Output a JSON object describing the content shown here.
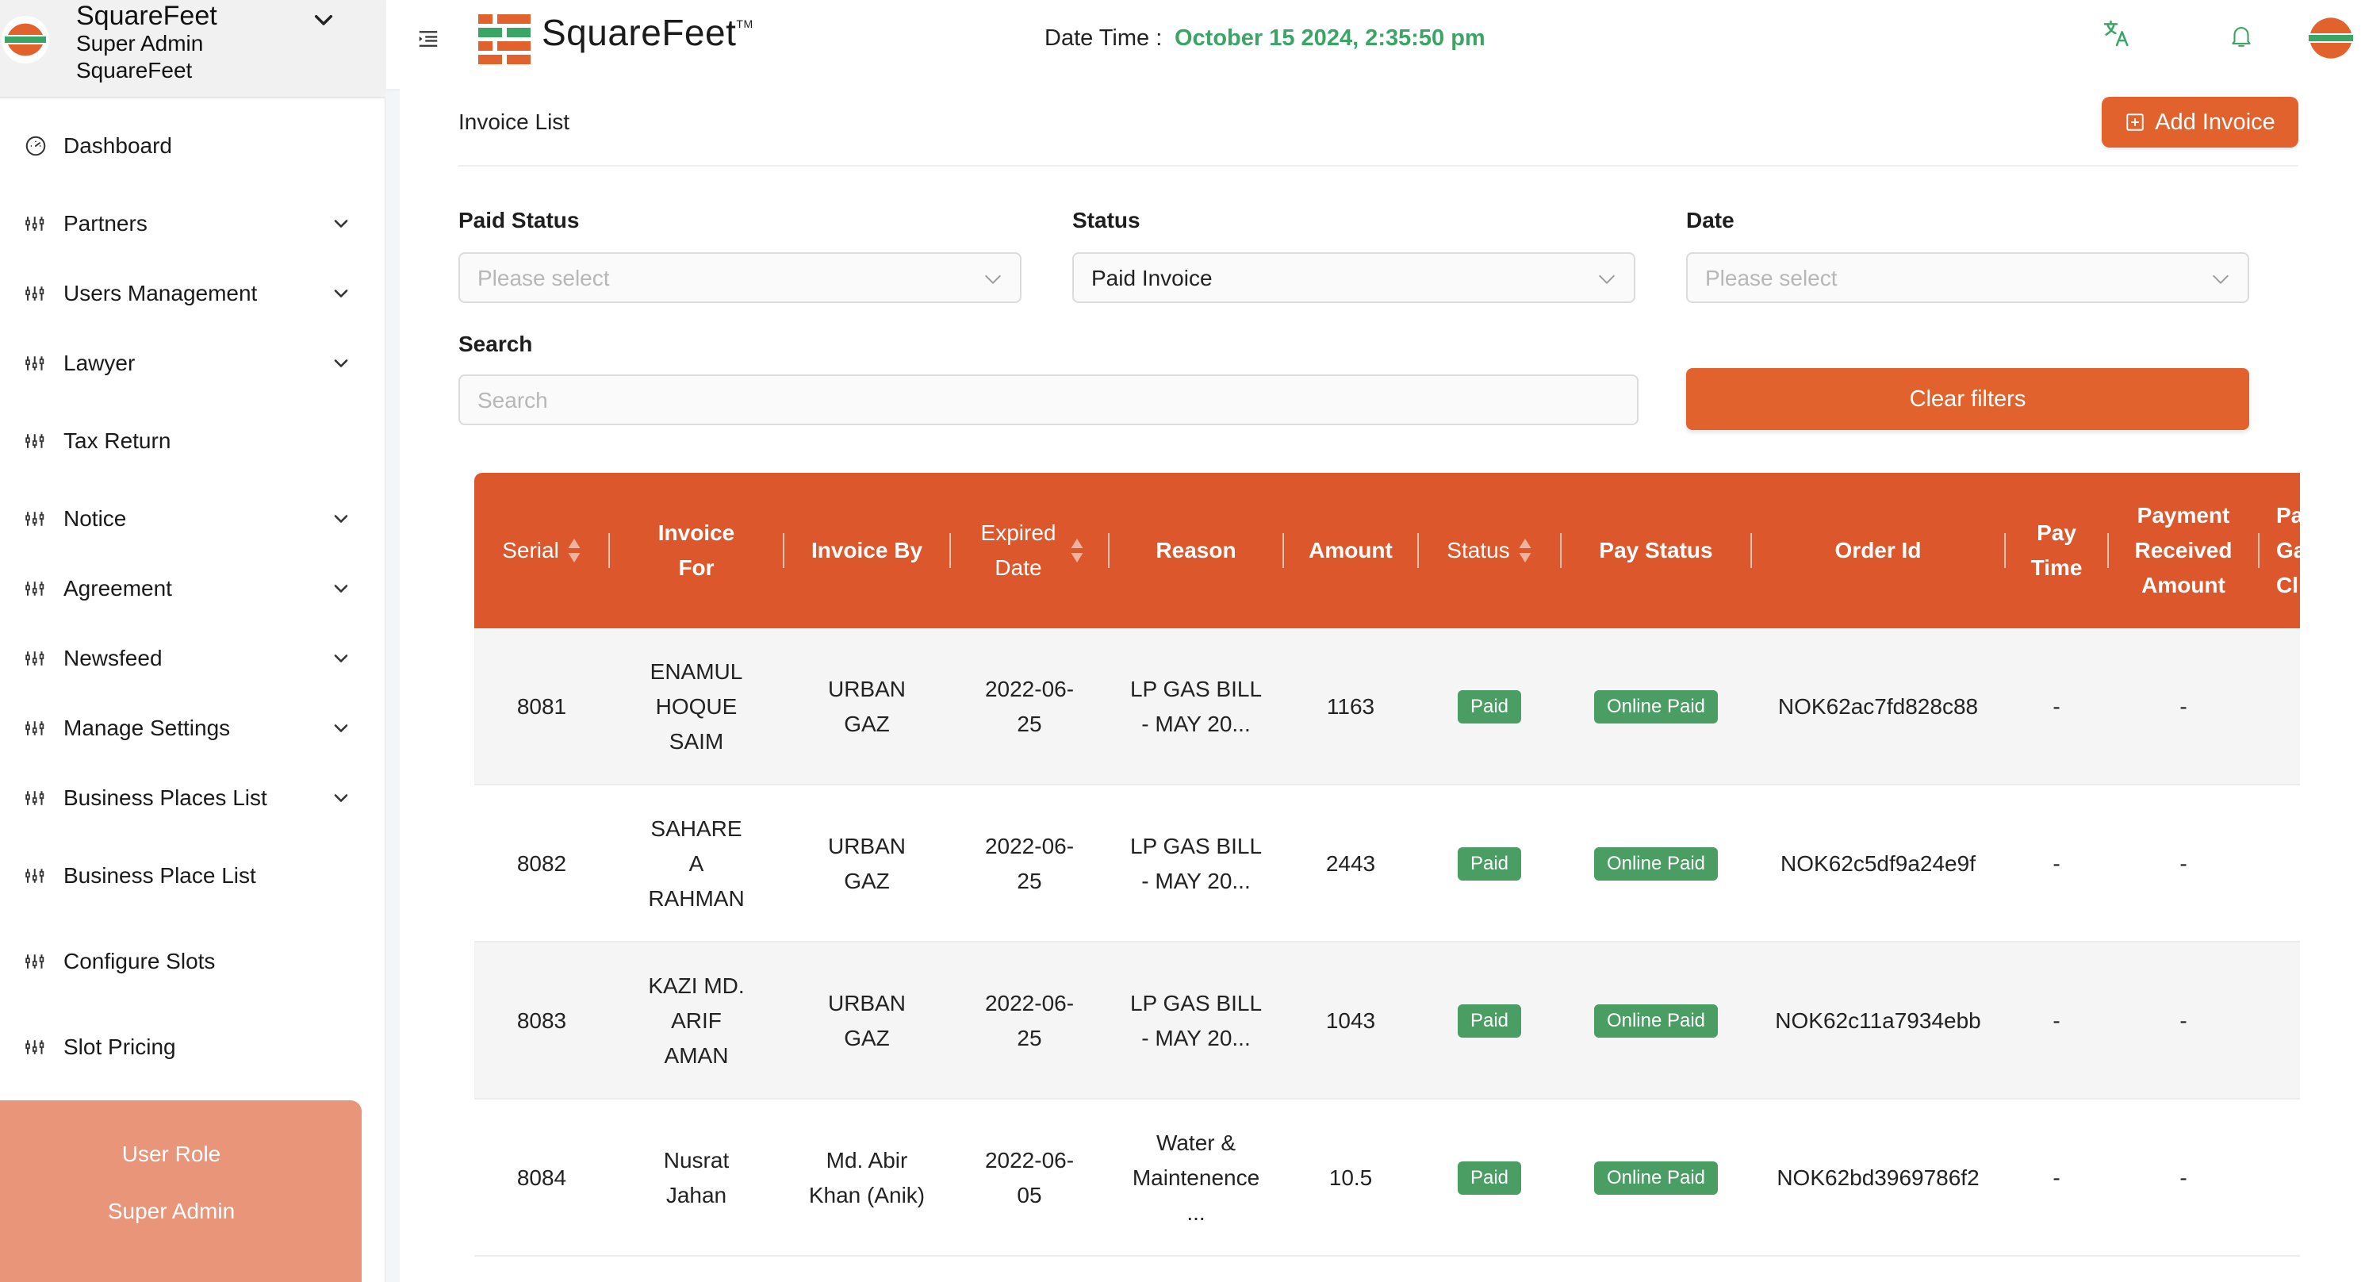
{
  "brand": {
    "name": "SquareFeet",
    "role": "Super Admin",
    "org": "SquareFeet"
  },
  "sidebar": {
    "items": [
      {
        "label": "Dashboard",
        "icon": "dashboard-icon",
        "has_children": false
      },
      {
        "label": "Partners",
        "icon": "sliders-icon",
        "has_children": true
      },
      {
        "label": "Users Management",
        "icon": "sliders-icon",
        "has_children": true
      },
      {
        "label": "Lawyer",
        "icon": "sliders-icon",
        "has_children": true
      },
      {
        "label": "Tax Return",
        "icon": "sliders-icon",
        "has_children": false
      },
      {
        "label": "Notice",
        "icon": "sliders-icon",
        "has_children": true
      },
      {
        "label": "Agreement",
        "icon": "sliders-icon",
        "has_children": true
      },
      {
        "label": "Newsfeed",
        "icon": "sliders-icon",
        "has_children": true
      },
      {
        "label": "Manage Settings",
        "icon": "sliders-icon",
        "has_children": true
      },
      {
        "label": "Business Places List",
        "icon": "sliders-icon",
        "has_children": true
      },
      {
        "label": "Business Place List",
        "icon": "sliders-icon",
        "has_children": false
      },
      {
        "label": "Configure Slots",
        "icon": "sliders-icon",
        "has_children": false
      },
      {
        "label": "Slot Pricing",
        "icon": "sliders-icon",
        "has_children": false
      }
    ],
    "role_box": {
      "title": "User Role",
      "value": "Super Admin"
    }
  },
  "topbar": {
    "brand": "SquareFeet",
    "trademark": "TM",
    "datetime_label": "Date Time :",
    "datetime_value": "October 15 2024, 2:35:50 pm"
  },
  "page": {
    "title": "Invoice List",
    "add_button": "Add Invoice"
  },
  "filters": {
    "paid_status": {
      "label": "Paid Status",
      "placeholder": "Please select"
    },
    "status": {
      "label": "Status",
      "value": "Paid Invoice"
    },
    "date": {
      "label": "Date",
      "placeholder": "Please select"
    },
    "search": {
      "label": "Search",
      "placeholder": "Search"
    },
    "clear_button": "Clear filters"
  },
  "table": {
    "headers": {
      "serial": "Serial",
      "invoice_for": "Invoice For",
      "invoice_by": "Invoice By",
      "expired_date": "Expired Date",
      "reason": "Reason",
      "amount": "Amount",
      "status": "Status",
      "pay_status": "Pay Status",
      "order_id": "Order Id",
      "pay_time": "Pay Time",
      "payment_received": "Payment Received Amount",
      "payment_gateway": "Pa Ga Cl"
    },
    "rows": [
      {
        "serial": "8081",
        "invoice_for": "ENAMUL HOQUE SAIM",
        "invoice_by": "URBAN GAZ",
        "expired_date": "2022-06-25",
        "reason": "LP GAS BILL - MAY 20...",
        "amount": "1163",
        "status": "Paid",
        "pay_status": "Online Paid",
        "order_id": "NOK62ac7fd828c88",
        "pay_time": "-",
        "payment_received": "-"
      },
      {
        "serial": "8082",
        "invoice_for": "SAHARE A RAHMAN",
        "invoice_by": "URBAN GAZ",
        "expired_date": "2022-06-25",
        "reason": "LP GAS BILL - MAY 20...",
        "amount": "2443",
        "status": "Paid",
        "pay_status": "Online Paid",
        "order_id": "NOK62c5df9a24e9f",
        "pay_time": "-",
        "payment_received": "-"
      },
      {
        "serial": "8083",
        "invoice_for": "KAZI MD. ARIF AMAN",
        "invoice_by": "URBAN GAZ",
        "expired_date": "2022-06-25",
        "reason": "LP GAS BILL - MAY 20...",
        "amount": "1043",
        "status": "Paid",
        "pay_status": "Online Paid",
        "order_id": "NOK62c11a7934ebb",
        "pay_time": "-",
        "payment_received": "-"
      },
      {
        "serial": "8084",
        "invoice_for": "Nusrat Jahan",
        "invoice_by": "Md. Abir Khan (Anik)",
        "expired_date": "2022-06-05",
        "reason": "Water & Maintenence ...",
        "amount": "10.5",
        "status": "Paid",
        "pay_status": "Online Paid",
        "order_id": "NOK62bd3969786f2",
        "pay_time": "-",
        "payment_received": "-"
      }
    ]
  },
  "colors": {
    "accent": "#e2622e",
    "table_header": "#dc582c",
    "datetime": "#3aa565",
    "badge": "#4a9d63",
    "role_box": "#e8957a"
  }
}
